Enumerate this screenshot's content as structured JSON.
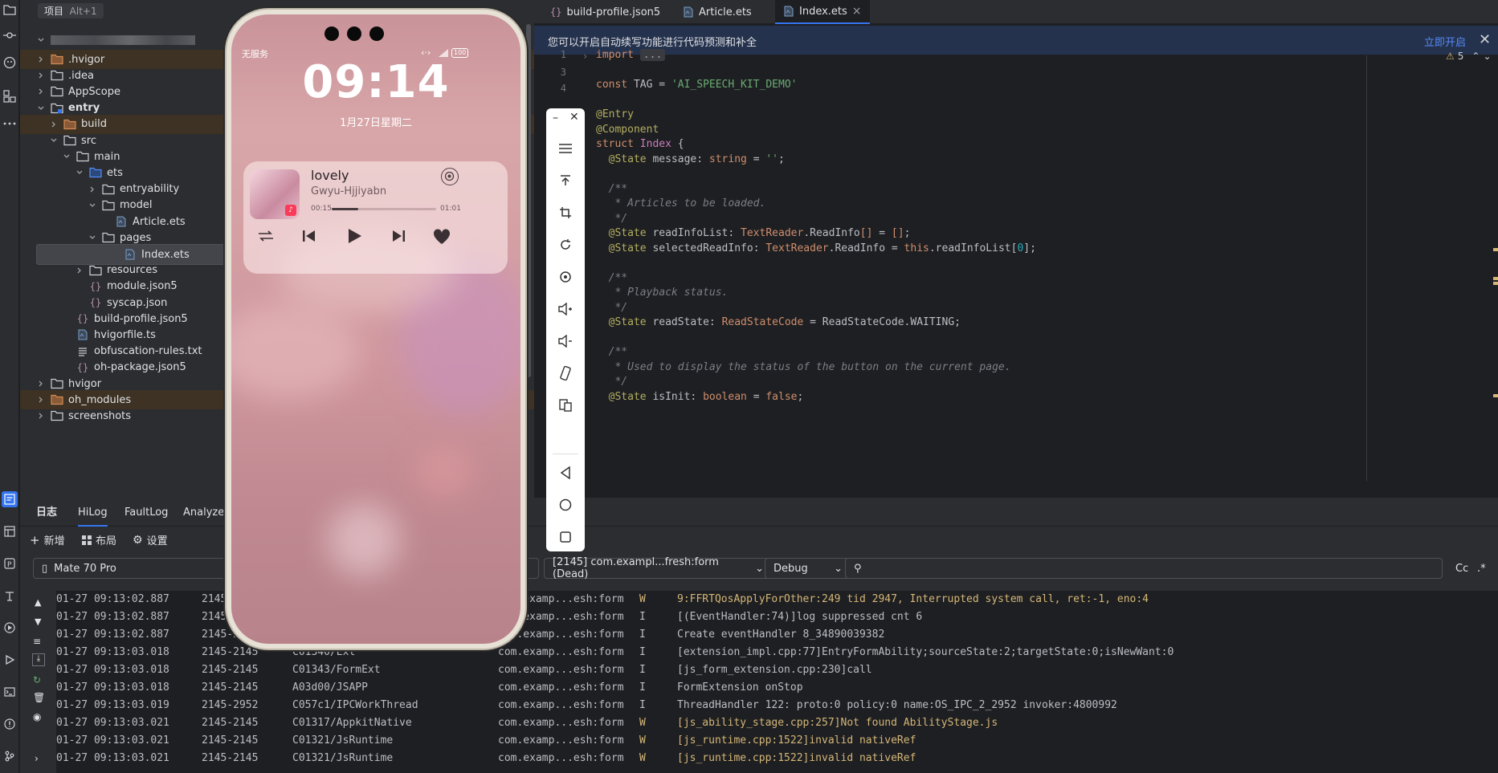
{
  "colors": {
    "accent": "#3574f0",
    "warn": "#d5b778",
    "string": "#6aab73",
    "keyword": "#cf8e6d",
    "annotation": "#b3ae60",
    "comment": "#7a7e85",
    "type": "#c77dbb",
    "number": "#2aacb8"
  },
  "project": {
    "header": "项目",
    "shortcut": "Alt+1",
    "root_label": "",
    "items": [
      {
        "label": ".hvigor",
        "indent": 1,
        "expanded": false,
        "kind": "folder-orange",
        "highlight": true
      },
      {
        "label": ".idea",
        "indent": 1,
        "expanded": false,
        "kind": "folder"
      },
      {
        "label": "AppScope",
        "indent": 1,
        "expanded": false,
        "kind": "folder"
      },
      {
        "label": "entry",
        "indent": 1,
        "expanded": true,
        "kind": "folder-module",
        "bold": true
      },
      {
        "label": "build",
        "indent": 2,
        "expanded": false,
        "kind": "folder-orange",
        "highlight": true
      },
      {
        "label": "src",
        "indent": 2,
        "expanded": true,
        "kind": "folder"
      },
      {
        "label": "main",
        "indent": 3,
        "expanded": true,
        "kind": "folder"
      },
      {
        "label": "ets",
        "indent": 4,
        "expanded": true,
        "kind": "folder-src"
      },
      {
        "label": "entryability",
        "indent": 5,
        "expanded": false,
        "kind": "folder"
      },
      {
        "label": "model",
        "indent": 5,
        "expanded": true,
        "kind": "folder"
      },
      {
        "label": "Article.ets",
        "indent": 6,
        "kind": "ets"
      },
      {
        "label": "pages",
        "indent": 5,
        "expanded": true,
        "kind": "folder"
      },
      {
        "label": "Index.ets",
        "indent": 6,
        "kind": "ets",
        "selected": true
      },
      {
        "label": "resources",
        "indent": 4,
        "expanded": false,
        "kind": "folder"
      },
      {
        "label": "module.json5",
        "indent": 4,
        "kind": "json"
      },
      {
        "label": "syscap.json",
        "indent": 4,
        "kind": "json"
      },
      {
        "label": "build-profile.json5",
        "indent": 3,
        "kind": "json"
      },
      {
        "label": "hvigorfile.ts",
        "indent": 3,
        "kind": "ts"
      },
      {
        "label": "obfuscation-rules.txt",
        "indent": 3,
        "kind": "txt"
      },
      {
        "label": "oh-package.json5",
        "indent": 3,
        "kind": "json"
      },
      {
        "label": "hvigor",
        "indent": 1,
        "expanded": false,
        "kind": "folder"
      },
      {
        "label": "oh_modules",
        "indent": 1,
        "expanded": false,
        "kind": "folder-orange",
        "highlight": true
      },
      {
        "label": "screenshots",
        "indent": 1,
        "expanded": false,
        "kind": "folder"
      }
    ]
  },
  "editor": {
    "tabs": [
      {
        "label": "build-profile.json5",
        "icon": "json-icon"
      },
      {
        "label": "Article.ets",
        "icon": "ets-icon"
      },
      {
        "label": "Index.ets",
        "icon": "ets-icon",
        "active": true
      }
    ],
    "banner": {
      "text": "您可以开启自动续写功能进行代码预测和补全",
      "action": "立即开启"
    },
    "warnings": "5",
    "line_numbers": [
      "1",
      "3",
      "4"
    ],
    "lines": [
      [
        {
          "t": "import ",
          "c": "kw"
        },
        {
          "t": "...",
          "c": "plain"
        }
      ],
      [],
      [
        {
          "t": "const ",
          "c": "kw"
        },
        {
          "t": "TAG",
          "c": "plain"
        },
        {
          "t": " = ",
          "c": "plain"
        },
        {
          "t": "'AI_SPEECH_KIT_DEMO'",
          "c": "str"
        }
      ],
      [],
      [
        {
          "t": "@Entry",
          "c": "ann"
        }
      ],
      [
        {
          "t": "@Component",
          "c": "ann"
        }
      ],
      [
        {
          "t": "struct ",
          "c": "kw"
        },
        {
          "t": "Index",
          "c": "ty"
        },
        {
          "t": " {",
          "c": "plain"
        }
      ],
      [
        {
          "t": "  @State ",
          "c": "ann"
        },
        {
          "t": "message",
          "c": "plain"
        },
        {
          "t": ": ",
          "c": "plain"
        },
        {
          "t": "string",
          "c": "kw"
        },
        {
          "t": " = ",
          "c": "plain"
        },
        {
          "t": "''",
          "c": "str"
        },
        {
          "t": ";",
          "c": "plain"
        }
      ],
      [],
      [
        {
          "t": "  /**",
          "c": "cm"
        }
      ],
      [
        {
          "t": "   * Articles to be loaded.",
          "c": "cm"
        }
      ],
      [
        {
          "t": "   */",
          "c": "cm"
        }
      ],
      [
        {
          "t": "  @State ",
          "c": "ann"
        },
        {
          "t": "readInfoList",
          "c": "plain"
        },
        {
          "t": ": ",
          "c": "plain"
        },
        {
          "t": "TextReader",
          "c": "kw"
        },
        {
          "t": ".ReadInfo",
          "c": "plain"
        },
        {
          "t": "[]",
          "c": "kw"
        },
        {
          "t": " = ",
          "c": "plain"
        },
        {
          "t": "[]",
          "c": "kw"
        },
        {
          "t": ";",
          "c": "plain"
        }
      ],
      [
        {
          "t": "  @State ",
          "c": "ann"
        },
        {
          "t": "selectedReadInfo",
          "c": "plain"
        },
        {
          "t": ": ",
          "c": "plain"
        },
        {
          "t": "TextReader",
          "c": "kw"
        },
        {
          "t": ".ReadInfo = ",
          "c": "plain"
        },
        {
          "t": "this",
          "c": "kw"
        },
        {
          "t": ".readInfoList[",
          "c": "plain"
        },
        {
          "t": "0",
          "c": "num"
        },
        {
          "t": "];",
          "c": "plain"
        }
      ],
      [],
      [
        {
          "t": "  /**",
          "c": "cm"
        }
      ],
      [
        {
          "t": "   * Playback status.",
          "c": "cm"
        }
      ],
      [
        {
          "t": "   */",
          "c": "cm"
        }
      ],
      [
        {
          "t": "  @State ",
          "c": "ann"
        },
        {
          "t": "readState",
          "c": "plain"
        },
        {
          "t": ": ",
          "c": "plain"
        },
        {
          "t": "ReadStateCode",
          "c": "kw"
        },
        {
          "t": " = ReadStateCode.WAITING;",
          "c": "plain"
        }
      ],
      [],
      [
        {
          "t": "  /**",
          "c": "cm"
        }
      ],
      [
        {
          "t": "   * Used to display the status of the button on the current page.",
          "c": "cm"
        }
      ],
      [
        {
          "t": "   */",
          "c": "cm"
        }
      ],
      [
        {
          "t": "  @State ",
          "c": "ann"
        },
        {
          "t": "isInit",
          "c": "plain"
        },
        {
          "t": ": ",
          "c": "plain"
        },
        {
          "t": "boolean",
          "c": "kw"
        },
        {
          "t": " = ",
          "c": "plain"
        },
        {
          "t": "false",
          "c": "kw"
        },
        {
          "t": ";",
          "c": "plain"
        }
      ]
    ]
  },
  "logs": {
    "tabs": [
      "日志",
      "HiLog",
      "FaultLog",
      "AnalyzeSt"
    ],
    "toolbar": {
      "new": "新增",
      "layout": "布局",
      "settings": "设置"
    },
    "device": "Mate 70 Pro",
    "process": "[2145] com.exampl...fresh:form (Dead)",
    "level": "Debug",
    "search_placeholder": "",
    "case_label": "Cc",
    "regex_label": ".*",
    "rows": [
      {
        "time": "01-27 09:13:02.887",
        "pid": "2145",
        "tag": "",
        "pkg": "com.examp...esh:form",
        "lvl": "W",
        "msg": "9:FFRTQosApplyForOther:249 tid 2947, Interrupted system call, ret:-1, eno:4"
      },
      {
        "time": "01-27 09:13:02.887",
        "pid": "2145",
        "tag": "",
        "pkg": "com.examp...esh:form",
        "lvl": "I",
        "msg": "[(EventHandler:74)]log suppressed cnt 6"
      },
      {
        "time": "01-27 09:13:02.887",
        "pid": "2145-2",
        "tag": "",
        "pkg": "com.examp...esh:form",
        "lvl": "I",
        "msg": "Create eventHandler 8_34890039382"
      },
      {
        "time": "01-27 09:13:03.018",
        "pid": "2145-2145",
        "tag": "C01340/Ext",
        "pkg": "com.examp...esh:form",
        "lvl": "I",
        "msg": "[extension_impl.cpp:77]EntryFormAbility;sourceState:2;targetState:0;isNewWant:0"
      },
      {
        "time": "01-27 09:13:03.018",
        "pid": "2145-2145",
        "tag": "C01343/FormExt",
        "pkg": "com.examp...esh:form",
        "lvl": "I",
        "msg": "[js_form_extension.cpp:230]call"
      },
      {
        "time": "01-27 09:13:03.018",
        "pid": "2145-2145",
        "tag": "A03d00/JSAPP",
        "pkg": "com.examp...esh:form",
        "lvl": "I",
        "msg": "FormExtension onStop"
      },
      {
        "time": "01-27 09:13:03.019",
        "pid": "2145-2952",
        "tag": "C057c1/IPCWorkThread",
        "pkg": "com.examp...esh:form",
        "lvl": "I",
        "msg": "ThreadHandler 122: proto:0 policy:0 name:OS_IPC_2_2952 invoker:4800992"
      },
      {
        "time": "01-27 09:13:03.021",
        "pid": "2145-2145",
        "tag": "C01317/AppkitNative",
        "pkg": "com.examp...esh:form",
        "lvl": "W",
        "msg": "[js_ability_stage.cpp:257]Not found AbilityStage.js"
      },
      {
        "time": "01-27 09:13:03.021",
        "pid": "2145-2145",
        "tag": "C01321/JsRuntime",
        "pkg": "com.examp...esh:form",
        "lvl": "W",
        "msg": "[js_runtime.cpp:1522]invalid nativeRef"
      },
      {
        "time": "01-27 09:13:03.021",
        "pid": "2145-2145",
        "tag": "C01321/JsRuntime",
        "pkg": "com.examp...esh:form",
        "lvl": "W",
        "msg": "[js_runtime.cpp:1522]invalid nativeRef"
      }
    ]
  },
  "phone": {
    "carrier": "无服务",
    "battery": "100",
    "time": "09:14",
    "date": "1月27日星期二",
    "song": "lovely",
    "artist": "Gwyu-Hjjiyabn",
    "elapsed": "00:15",
    "total": "01:01",
    "progress": 0.25
  }
}
